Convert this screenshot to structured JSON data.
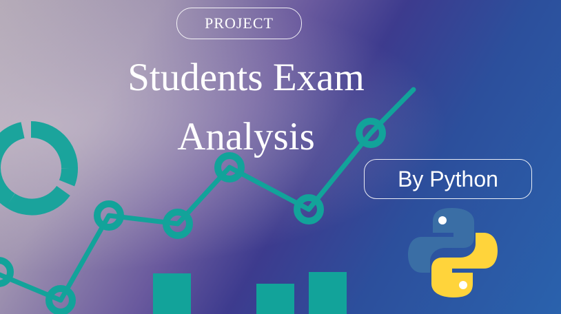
{
  "badge": {
    "label": "PROJECT"
  },
  "title": {
    "line1": "Students Exam",
    "line2": "Analysis"
  },
  "byline": {
    "label": "By Python"
  },
  "icons": {
    "logo": "python-logo-icon",
    "chart": "line-chart-icon",
    "donut": "donut-chart-icon",
    "bars": "bar-chart-icon"
  },
  "colors": {
    "accent": "#12a39a",
    "python_blue": "#3a6ea5",
    "python_yellow": "#ffd43b"
  }
}
